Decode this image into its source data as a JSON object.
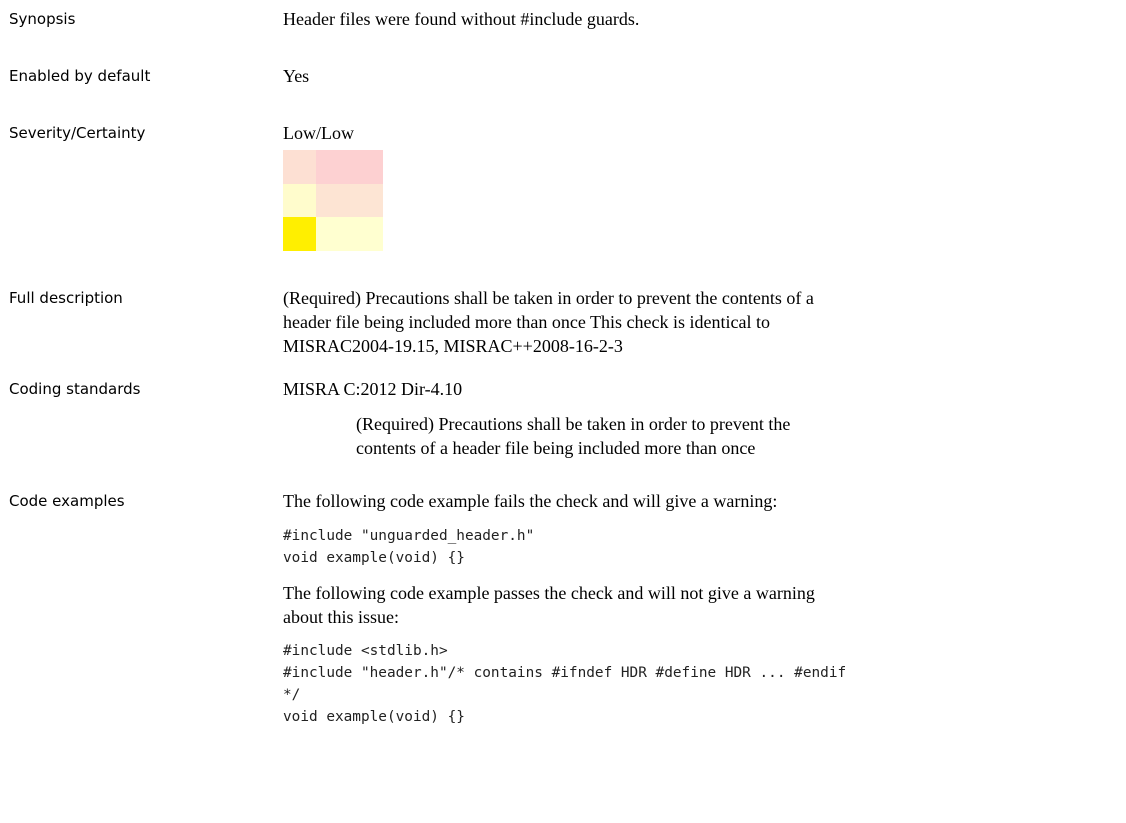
{
  "rows": {
    "synopsis": {
      "label": "Synopsis",
      "value": "Header files were found without #include guards."
    },
    "enabled": {
      "label": "Enabled by default",
      "value": "Yes"
    },
    "severity": {
      "label": "Severity/Certainty",
      "value": "Low/Low",
      "matrix_colors": [
        [
          "#fde0d3",
          "#fdd1d2",
          "#fdd0d1"
        ],
        [
          "#fffccc",
          "#fde4d3",
          "#fde5d4"
        ],
        [
          "#ffef00",
          "#ffffd0",
          "#ffffd0"
        ]
      ],
      "highlight": {
        "severity": "Low",
        "certainty": "Low"
      }
    },
    "full_description": {
      "label": "Full description",
      "value": "(Required) Precautions shall be taken in order to prevent the contents of a header file being included more than once This check is identical to MISRAC2004-19.15, MISRAC++2008-16-2-3"
    },
    "coding_standards": {
      "label": "Coding standards",
      "standard": "MISRA C:2012 Dir-4.10",
      "standard_description": "(Required) Precautions shall be taken in order to prevent the contents of a header file being included more than once"
    },
    "code_examples": {
      "label": "Code examples",
      "fail_intro": "The following code example fails the check and will give a warning:",
      "fail_code": "#include \"unguarded_header.h\"\nvoid example(void) {}",
      "pass_intro": "The following code example passes the check and will not give a warning about this issue:",
      "pass_code": "#include <stdlib.h>\n#include \"header.h\"/* contains #ifndef HDR #define HDR ... #endif\n*/\nvoid example(void) {}"
    }
  }
}
